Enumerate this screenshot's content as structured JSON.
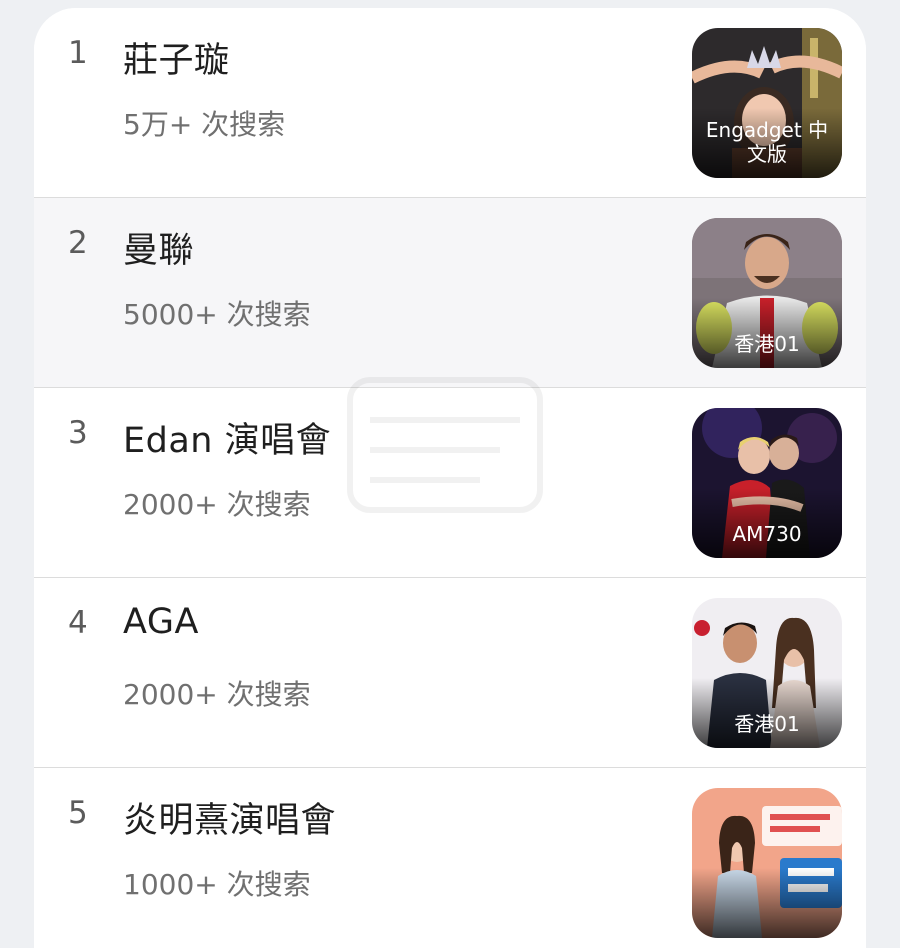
{
  "trends": [
    {
      "rank": "1",
      "title": "莊子璇",
      "searches": "5万+ 次搜索",
      "source": "Engadget 中文版",
      "highlighted": false
    },
    {
      "rank": "2",
      "title": "曼聯",
      "searches": "5000+ 次搜索",
      "source": "香港01",
      "highlighted": true
    },
    {
      "rank": "3",
      "title": "Edan 演唱會",
      "searches": "2000+ 次搜索",
      "source": "AM730",
      "highlighted": false
    },
    {
      "rank": "4",
      "title": "AGA",
      "searches": "2000+ 次搜索",
      "source": "香港01",
      "highlighted": false
    },
    {
      "rank": "5",
      "title": "炎明熹演唱會",
      "searches": "1000+ 次搜索",
      "source": "",
      "highlighted": false
    }
  ],
  "colors": {
    "page_background": "#eef0f3",
    "card_background": "#ffffff",
    "highlight_row": "#f6f6f8",
    "title_text": "#1f1f1f",
    "secondary_text": "#707070"
  },
  "icons": [
    "thumbnail-crown-scene",
    "thumbnail-goalkeeper",
    "thumbnail-concert-hug",
    "thumbnail-couple-pose",
    "thumbnail-poster"
  ]
}
